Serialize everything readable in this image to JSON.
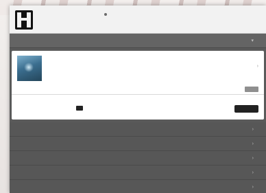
{
  "header": {
    "brand_line_1": "",
    "brand_line_2": ""
  },
  "days": [
    {
      "weekday": "",
      "date": "",
      "label": ""
    },
    {
      "weekday": "",
      "date": "",
      "label": ""
    },
    {
      "weekday": "",
      "date": "",
      "label": ""
    },
    {
      "weekday": "",
      "date": "",
      "label": ""
    },
    {
      "weekday": "",
      "date": "",
      "label": ""
    }
  ],
  "selected": {
    "weekday": "",
    "date": "",
    "label": ""
  },
  "show": {
    "title": "",
    "line_1": "",
    "line_2": "",
    "line_3": "",
    "seat_info": "",
    "seat_note": "",
    "price": "",
    "ticket_text": "",
    "buy_label": ""
  },
  "colors": {
    "accent": "#d12f2f",
    "dark_button": "#222222"
  }
}
